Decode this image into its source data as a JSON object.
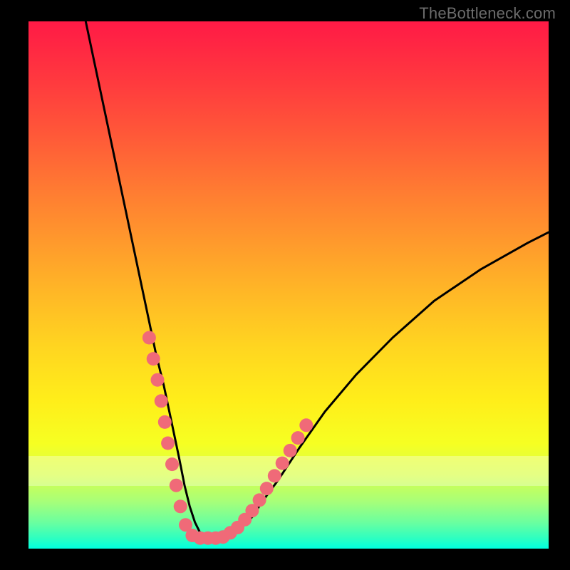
{
  "watermark": "TheBottleneck.com",
  "chart_data": {
    "type": "line",
    "title": "",
    "xlabel": "",
    "ylabel": "",
    "xlim": [
      0,
      100
    ],
    "ylim": [
      0,
      100
    ],
    "grid": false,
    "legend": false,
    "series": [
      {
        "name": "curve",
        "color": "#000000",
        "x": [
          11,
          14,
          17,
          20,
          23,
          24.5,
          26,
          27.5,
          29,
          30,
          31,
          32,
          33,
          34,
          35,
          37,
          40,
          43,
          45,
          48,
          52,
          57,
          63,
          70,
          78,
          87,
          96,
          100
        ],
        "y": [
          100,
          86,
          72,
          58,
          44,
          37,
          31,
          24,
          17,
          12,
          8,
          5,
          3,
          2,
          2,
          2,
          3,
          6,
          9,
          13,
          19,
          26,
          33,
          40,
          47,
          53,
          58,
          60
        ]
      }
    ],
    "markers": {
      "color": "#f06a78",
      "radius_pct": 1.3,
      "points": [
        {
          "x": 23.2,
          "y": 40
        },
        {
          "x": 24.0,
          "y": 36
        },
        {
          "x": 24.8,
          "y": 32
        },
        {
          "x": 25.5,
          "y": 28
        },
        {
          "x": 26.2,
          "y": 24
        },
        {
          "x": 26.8,
          "y": 20
        },
        {
          "x": 27.6,
          "y": 16
        },
        {
          "x": 28.4,
          "y": 12
        },
        {
          "x": 29.2,
          "y": 8
        },
        {
          "x": 30.2,
          "y": 4.5
        },
        {
          "x": 31.5,
          "y": 2.5
        },
        {
          "x": 33.0,
          "y": 2.0
        },
        {
          "x": 34.5,
          "y": 2.0
        },
        {
          "x": 36.0,
          "y": 2.0
        },
        {
          "x": 37.4,
          "y": 2.2
        },
        {
          "x": 38.8,
          "y": 3.0
        },
        {
          "x": 40.2,
          "y": 4.0
        },
        {
          "x": 41.6,
          "y": 5.5
        },
        {
          "x": 43.0,
          "y": 7.2
        },
        {
          "x": 44.4,
          "y": 9.2
        },
        {
          "x": 45.8,
          "y": 11.4
        },
        {
          "x": 47.3,
          "y": 13.8
        },
        {
          "x": 48.8,
          "y": 16.2
        },
        {
          "x": 50.3,
          "y": 18.6
        },
        {
          "x": 51.8,
          "y": 21.0
        },
        {
          "x": 53.4,
          "y": 23.4
        }
      ]
    },
    "green_band_y": [
      14,
      20
    ]
  }
}
